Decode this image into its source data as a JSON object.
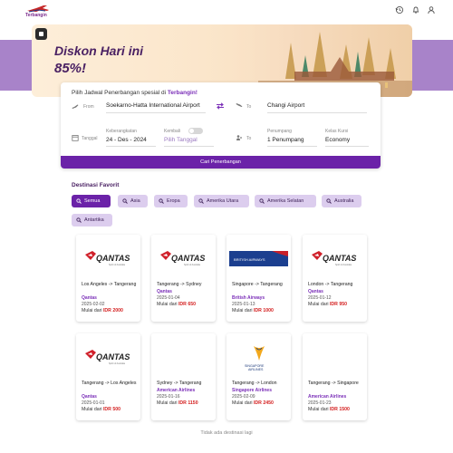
{
  "header": {
    "logo_text": "Terbangin",
    "icons": [
      "history-icon",
      "bell-icon",
      "user-icon"
    ]
  },
  "promo": {
    "title": "Diskon Hari ini",
    "percent": "85%!"
  },
  "search": {
    "title_prefix": "Pilih Jadwal Penerbangan spesial di ",
    "title_brand": "Terbangin!",
    "from_label": "From",
    "from_value": "Soekarno-Hatta International Airport",
    "to_label": "To",
    "to_value": "Changi Airport",
    "date_label": "Tanggal",
    "depart_label": "Keberangkatan",
    "depart_value": "24 - Des - 2024",
    "return_label": "Kembali",
    "return_placeholder": "Pilih Tanggal",
    "to_label_2": "To",
    "passenger_label": "Penumpang",
    "passenger_value": "1 Penumpang",
    "class_label": "Kelas Kursi",
    "class_value": "Economy",
    "button": "Cari Penerbangan"
  },
  "favorites": {
    "title": "Destinasi Favorit",
    "filters": [
      "Semua",
      "Asia",
      "Eropa",
      "Amerika Utara",
      "Amerika Selatan",
      "Australia",
      "Antartika"
    ],
    "active_filter": "Semua",
    "cards": [
      {
        "route": "Los Angeles -> Tangerang",
        "airline": "Qantas",
        "date": "2025-02-02",
        "price_prefix": "Mulai dari",
        "price": "IDR 2000",
        "logo": "qantas"
      },
      {
        "route": "Tangerang -> Sydney",
        "airline": "Qantas",
        "date": "2025-01-04",
        "price_prefix": "Mulai dari",
        "price": "IDR 650",
        "logo": "qantas"
      },
      {
        "route": "Singapore -> Tangerang",
        "airline": "British Airways",
        "date": "2025-01-13",
        "price_prefix": "Mulai dari",
        "price": "IDR 1000",
        "logo": "british-airways"
      },
      {
        "route": "London -> Tangerang",
        "airline": "Qantas",
        "date": "2025-01-12",
        "price_prefix": "Mulai dari",
        "price": "IDR 950",
        "logo": "qantas"
      },
      {
        "route": "Tangerang -> Los Angeles",
        "airline": "Qantas",
        "date": "2025-01-01",
        "price_prefix": "Mulai dari",
        "price": "IDR 500",
        "logo": "qantas"
      },
      {
        "route": "Sydney -> Tangerang",
        "airline": "American Airlines",
        "date": "2025-01-16",
        "price_prefix": "Mulai dari",
        "price": "IDR 1150",
        "logo": "blank"
      },
      {
        "route": "Tangerang -> London",
        "airline": "Singapore Airlines",
        "date": "2025-02-09",
        "price_prefix": "Mulai dari",
        "price": "IDR 2450",
        "logo": "singapore-airlines"
      },
      {
        "route": "Tangerang -> Singapore",
        "airline": "American Airlines",
        "date": "2025-01-23",
        "price_prefix": "Mulai dari",
        "price": "IDR 1500",
        "logo": "blank"
      }
    ],
    "no_more": "Tidak ada destinasi lagi"
  },
  "colors": {
    "brand_purple": "#6b22a8",
    "band": "#a883c9",
    "price_red": "#d42020"
  }
}
